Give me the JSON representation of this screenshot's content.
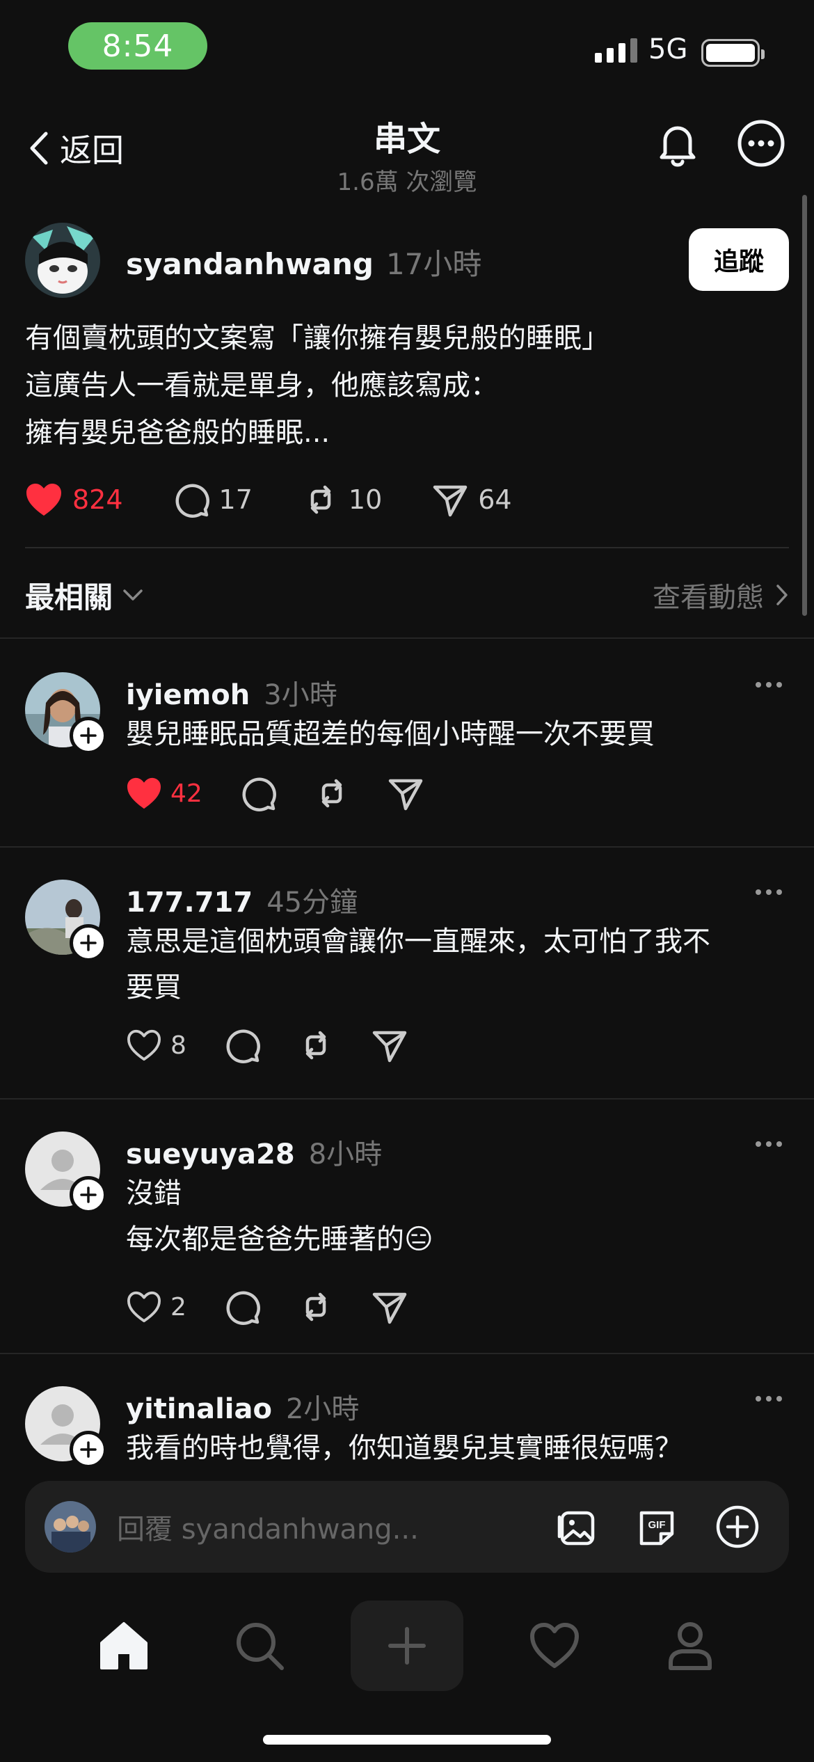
{
  "status_bar": {
    "time": "8:54",
    "network": "5G"
  },
  "header": {
    "back_label": "返回",
    "title": "串文",
    "subtitle": "1.6萬 次瀏覽"
  },
  "post": {
    "username": "syandanhwang",
    "time": "17小時",
    "follow_label": "追蹤",
    "lines": [
      "有個賣枕頭的文案寫「讓你擁有嬰兒般的睡眠」",
      "這廣告人一看就是單身，他應該寫成：",
      "擁有嬰兒爸爸般的睡眠..."
    ],
    "likes": "824",
    "comments": "17",
    "reposts": "10",
    "shares": "64"
  },
  "sort": {
    "label": "最相關",
    "activity_label": "查看動態"
  },
  "replies": [
    {
      "username": "iyiemoh",
      "time": "3小時",
      "lines": [
        "嬰兒睡眠品質超差的每個小時醒一次不要買"
      ],
      "likes": "42",
      "liked": true
    },
    {
      "username": "177.717",
      "time": "45分鐘",
      "lines": [
        "意思是這個枕頭會讓你一直醒來，太可怕了我不",
        "要買"
      ],
      "likes": "8",
      "liked": false
    },
    {
      "username": "sueyuya28",
      "time": "8小時",
      "lines": [
        "沒錯",
        "每次都是爸爸先睡著的😑"
      ],
      "likes": "2",
      "liked": false
    },
    {
      "username": "yitinaliao",
      "time": "2小時",
      "lines": [
        "我看的時也覺得，你知道嬰兒其實睡很短嗎？"
      ],
      "likes": "",
      "liked": false
    }
  ],
  "composer": {
    "placeholder": "回覆 syandanhwang..."
  },
  "tabs": [
    "home-icon",
    "search-icon",
    "create-icon",
    "activity-icon",
    "profile-icon"
  ],
  "colors": {
    "background": "#101010",
    "like": "#ff3040",
    "status_pill": "#65c466",
    "muted": "#777777"
  }
}
